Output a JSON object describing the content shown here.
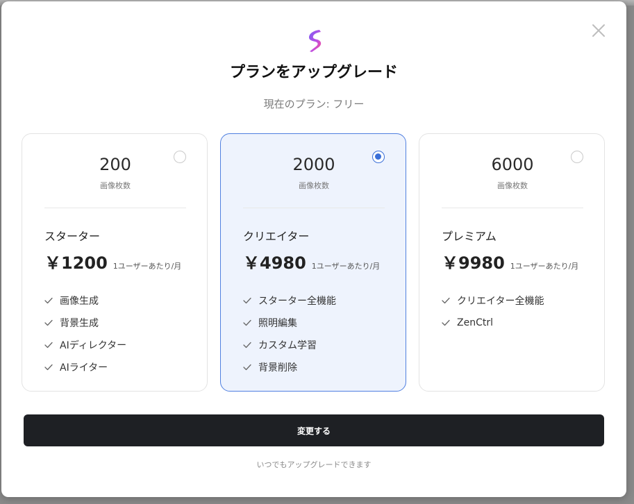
{
  "modal": {
    "title": "プランをアップグレード",
    "current_plan": "現在のプラン: フリー",
    "submit_label": "変更する",
    "footnote": "いつでもアップグレードできます",
    "colors": {
      "accent": "#3a6fd8",
      "selected_bg": "#eef3fd",
      "button_bg": "#1e2024"
    }
  },
  "plans": [
    {
      "count": "200",
      "count_label": "画像枚数",
      "name": "スターター",
      "price": "￥1200",
      "per": "1ユーザーあたり/月",
      "selected": false,
      "features": [
        "画像生成",
        "背景生成",
        "AIディレクター",
        "AIライター"
      ]
    },
    {
      "count": "2000",
      "count_label": "画像枚数",
      "name": "クリエイター",
      "price": "￥4980",
      "per": "1ユーザーあたり/月",
      "selected": true,
      "features": [
        "スターター全機能",
        "照明編集",
        "カスタム学習",
        "背景削除"
      ]
    },
    {
      "count": "6000",
      "count_label": "画像枚数",
      "name": "プレミアム",
      "price": "￥9980",
      "per": "1ユーザーあたり/月",
      "selected": false,
      "features": [
        "クリエイター全機能",
        "ZenCtrl"
      ]
    }
  ],
  "icons": {
    "close": "close-icon",
    "logo": "brand-logo-icon",
    "check": "check-icon"
  }
}
